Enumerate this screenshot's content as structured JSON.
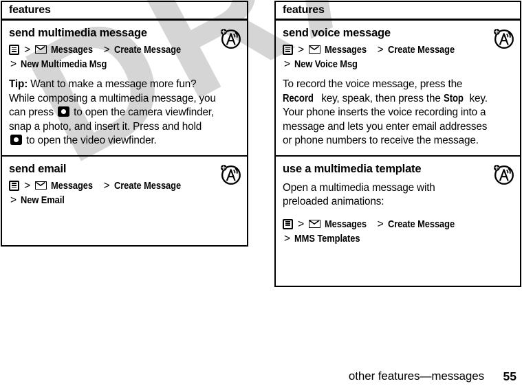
{
  "document": {
    "watermark_text": "DRAFT",
    "footer": {
      "title": "other features—messages",
      "page_number": "55"
    }
  },
  "icons": {
    "menu": "menu-key-icon",
    "envelope": "envelope-icon",
    "camera": "camera-key-icon",
    "network": "network-feature-badge-icon"
  },
  "tables": {
    "left": {
      "header": "features",
      "rows": [
        {
          "title": "send multimedia message",
          "badge": "network-feature-badge-icon",
          "path": {
            "line1_segments": [
              "Messages",
              "Create Message"
            ],
            "line2_segments": [
              "New Multimedia Msg"
            ]
          },
          "paragraphs": [
            {
              "lead": "Tip:",
              "parts": [
                {
                  "type": "text",
                  "value": " Want to make a message more fun? While composing a multimedia message, you can press "
                },
                {
                  "type": "icon",
                  "value": "camera-key-icon"
                },
                {
                  "type": "text",
                  "value": " to open the camera viewfinder, snap a photo, and insert it. Press and hold "
                },
                {
                  "type": "icon",
                  "value": "camera-key-icon"
                },
                {
                  "type": "text",
                  "value": " to open the video viewfinder."
                }
              ]
            }
          ]
        },
        {
          "title": "send email",
          "badge": "network-feature-badge-icon",
          "path": {
            "line1_segments": [
              "Messages",
              "Create Message"
            ],
            "line2_segments": [
              "New Email"
            ]
          },
          "paragraphs": []
        }
      ]
    },
    "right": {
      "header": "features",
      "rows": [
        {
          "title": "send voice message",
          "badge": "network-feature-badge-icon",
          "path": {
            "line1_segments": [
              "Messages",
              "Create Message"
            ],
            "line2_segments": [
              "New Voice Msg"
            ]
          },
          "paragraphs": [
            {
              "lead": "",
              "parts": [
                {
                  "type": "text",
                  "value": "To record the voice message, press the "
                },
                {
                  "type": "key",
                  "value": "Record"
                },
                {
                  "type": "text",
                  "value": " key, speak, then press the "
                },
                {
                  "type": "key",
                  "value": "Stop"
                },
                {
                  "type": "text",
                  "value": " key. Your phone inserts the voice recording into a message and lets you enter email addresses or phone numbers to receive the message."
                }
              ]
            }
          ]
        },
        {
          "title": "use a multimedia template",
          "badge": "network-feature-badge-icon",
          "path": {
            "line1_segments": [
              "Messages",
              "Create Message"
            ],
            "line2_segments": [
              "MMS Templates"
            ]
          },
          "paragraphs": [
            {
              "lead": "",
              "parts": [
                {
                  "type": "text",
                  "value": "Open a multimedia message with preloaded animations:"
                }
              ]
            }
          ]
        }
      ]
    }
  }
}
